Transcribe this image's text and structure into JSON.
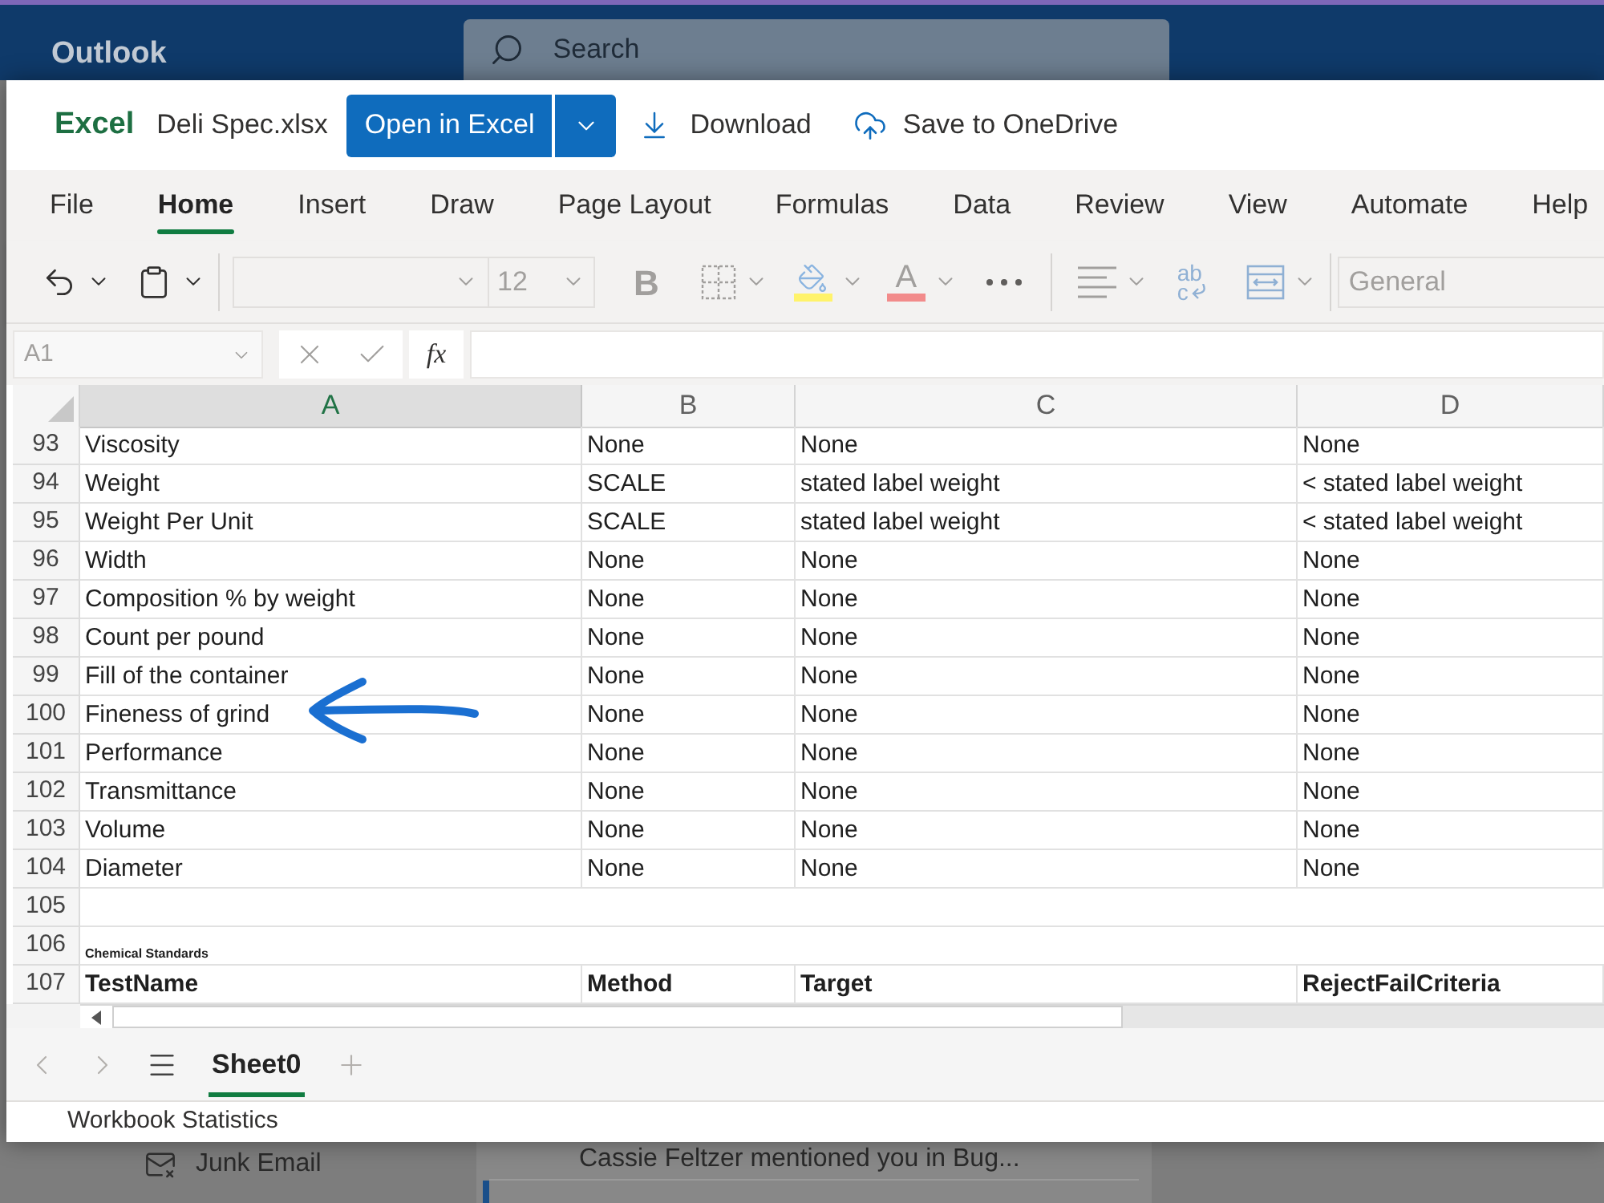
{
  "outlook": {
    "app_name": "Outlook",
    "search": {
      "placeholder": "Search"
    },
    "folder": "Junk Email",
    "message_preview": "Cassie Feltzer mentioned you in Bug..."
  },
  "excel": {
    "app_name": "Excel",
    "file_name": "Deli Spec.xlsx",
    "actions": [
      {
        "kind": "open",
        "label": "Open in Excel"
      },
      {
        "kind": "download",
        "label": "Download"
      },
      {
        "kind": "save",
        "label": "Save to OneDrive"
      }
    ],
    "ribbon_tabs": [
      {
        "label": "File",
        "selected": false
      },
      {
        "label": "Home",
        "selected": true
      },
      {
        "label": "Insert",
        "selected": false
      },
      {
        "label": "Draw",
        "selected": false
      },
      {
        "label": "Page Layout",
        "selected": false
      },
      {
        "label": "Formulas",
        "selected": false
      },
      {
        "label": "Data",
        "selected": false
      },
      {
        "label": "Review",
        "selected": false
      },
      {
        "label": "View",
        "selected": false
      },
      {
        "label": "Automate",
        "selected": false
      },
      {
        "label": "Help",
        "selected": false
      }
    ],
    "toolbar": {
      "disabled": true,
      "font_size": "12",
      "bold": "B",
      "font_color": "A",
      "wrap_text": [
        "ab",
        "c"
      ],
      "number_format": "General"
    },
    "formula_bar": {
      "name_box": "A1",
      "name_box_disabled": true,
      "function_label": "fx"
    },
    "columns": [
      {
        "label": "A",
        "selected": true
      },
      {
        "label": "B",
        "selected": false
      },
      {
        "label": "C",
        "selected": false
      },
      {
        "label": "D",
        "selected": false
      }
    ],
    "rows": [
      {
        "number": "93",
        "kind": "data",
        "cells": [
          "Viscosity",
          "None",
          "None",
          "None"
        ]
      },
      {
        "number": "94",
        "kind": "data",
        "cells": [
          "Weight",
          "SCALE",
          "stated label weight",
          "< stated label weight"
        ]
      },
      {
        "number": "95",
        "kind": "data",
        "cells": [
          "Weight Per Unit",
          "SCALE",
          "stated label weight",
          "< stated label weight"
        ]
      },
      {
        "number": "96",
        "kind": "data",
        "cells": [
          "Width",
          "None",
          "None",
          "None"
        ]
      },
      {
        "number": "97",
        "kind": "data",
        "cells": [
          "Composition % by weight",
          "None",
          "None",
          "None"
        ]
      },
      {
        "number": "98",
        "kind": "data",
        "cells": [
          "Count per pound",
          "None",
          "None",
          "None"
        ]
      },
      {
        "number": "99",
        "kind": "data",
        "cells": [
          "Fill of the container",
          "None",
          "None",
          "None"
        ]
      },
      {
        "number": "100",
        "kind": "data",
        "cells": [
          "Fineness of grind",
          "None",
          "None",
          "None"
        ]
      },
      {
        "number": "101",
        "kind": "data",
        "cells": [
          "Performance",
          "None",
          "None",
          "None"
        ]
      },
      {
        "number": "102",
        "kind": "data",
        "cells": [
          "Transmittance",
          "None",
          "None",
          "None"
        ]
      },
      {
        "number": "103",
        "kind": "data",
        "cells": [
          "Volume",
          "None",
          "None",
          "None"
        ]
      },
      {
        "number": "104",
        "kind": "data",
        "cells": [
          "Diameter",
          "None",
          "None",
          "None"
        ]
      },
      {
        "number": "105",
        "kind": "blank"
      },
      {
        "number": "106",
        "kind": "caption",
        "cells": [
          "Chemical Standards"
        ]
      },
      {
        "number": "107",
        "kind": "header",
        "cells": [
          "TestName",
          "Method",
          "Target",
          "RejectFailCriteria"
        ]
      }
    ],
    "sheet_navigation": {
      "disabled": true
    },
    "sheet_tabs": [
      {
        "label": "Sheet0",
        "selected": true
      }
    ],
    "status_bar": "Workbook Statistics"
  }
}
